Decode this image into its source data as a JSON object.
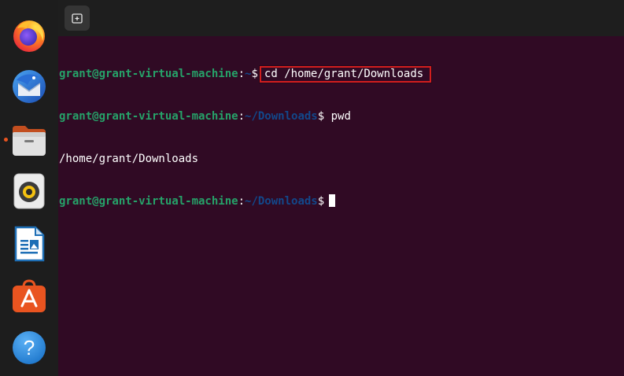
{
  "dock": {
    "items": [
      {
        "name": "firefox-icon"
      },
      {
        "name": "thunderbird-icon"
      },
      {
        "name": "files-icon"
      },
      {
        "name": "rhythmbox-icon"
      },
      {
        "name": "libreoffice-writer-icon"
      },
      {
        "name": "app-center-icon"
      },
      {
        "name": "help-icon",
        "glyph": "?"
      }
    ]
  },
  "terminal": {
    "new_tab_icon": "new-tab-icon",
    "lines": [
      {
        "user": "grant@grant-virtual-machine",
        "colon": ":",
        "path": "~",
        "dollar": "$",
        "command": "cd /home/grant/Downloads"
      },
      {
        "user": "grant@grant-virtual-machine",
        "colon": ":",
        "path": "~/Downloads",
        "dollar": "$",
        "command": " pwd"
      },
      {
        "output": "/home/grant/Downloads"
      },
      {
        "user": "grant@grant-virtual-machine",
        "colon": ":",
        "path": "~/Downloads",
        "dollar": "$"
      }
    ]
  },
  "colors": {
    "terminal_bg": "#300a24",
    "prompt_user": "#26a269",
    "prompt_path": "#12488b",
    "highlight_border": "#d21e1e",
    "accent": "#e95420"
  }
}
